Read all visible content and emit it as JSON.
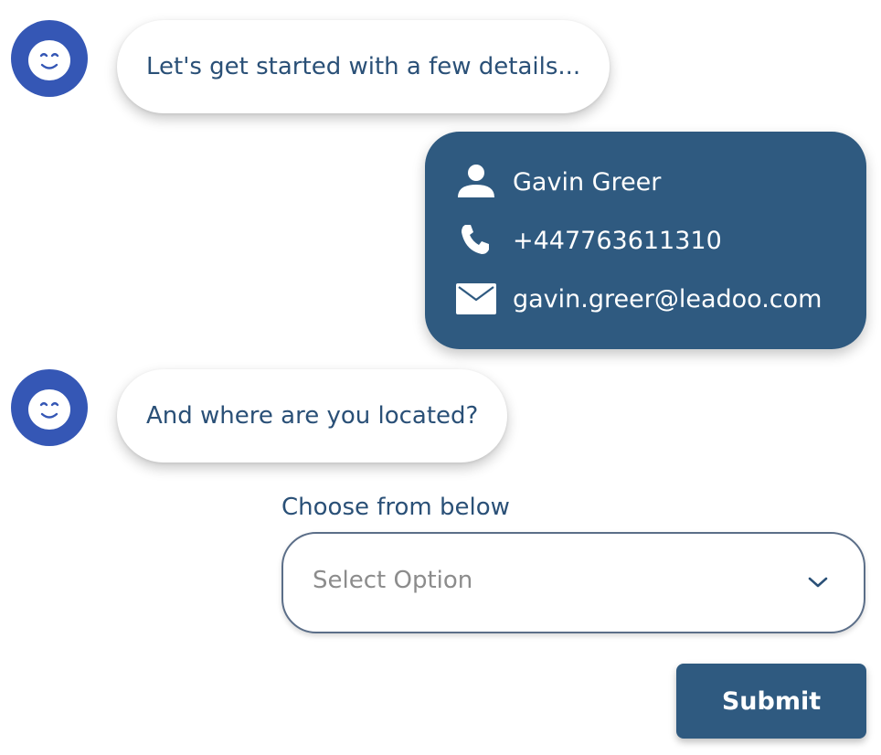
{
  "chat": {
    "bot_message_1": "Let's get started with a few details...",
    "bot_message_2": "And where are you located?"
  },
  "user_details": {
    "name": "Gavin Greer",
    "phone": "+447763611310",
    "email": "gavin.greer@leadoo.com"
  },
  "location_form": {
    "label": "Choose from below",
    "select_placeholder": "Select Option",
    "submit_label": "Submit"
  },
  "colors": {
    "avatar_bg": "#3557b5",
    "bubble_dark": "#2f5a80",
    "text_blue": "#2a5077",
    "placeholder_gray": "#8c8c8c"
  },
  "icons": {
    "avatar": "robot-face-icon",
    "name": "person-icon",
    "phone": "phone-icon",
    "email": "envelope-icon",
    "select": "chevron-down-icon"
  }
}
